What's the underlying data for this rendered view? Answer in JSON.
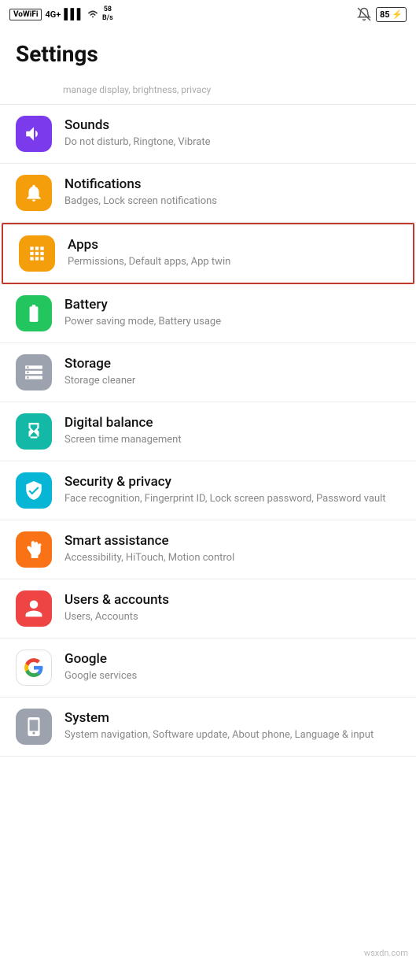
{
  "statusBar": {
    "left": {
      "wifiLabel": "VoWiFi",
      "networkType": "4G+",
      "signalBars": "|||",
      "wifiIcon": "wifi",
      "speedValue": "58",
      "speedUnit": "B/s"
    },
    "right": {
      "bellMuted": true,
      "batteryPercent": "85",
      "charging": true
    }
  },
  "pageTitle": "Settings",
  "topPartialText": "...manage display, brightness, privacy",
  "items": [
    {
      "id": "sounds",
      "title": "Sounds",
      "subtitle": "Do not disturb, Ringtone, Vibrate",
      "iconBg": "bg-purple",
      "iconType": "volume"
    },
    {
      "id": "notifications",
      "title": "Notifications",
      "subtitle": "Badges, Lock screen notifications",
      "iconBg": "bg-amber",
      "iconType": "bell"
    },
    {
      "id": "apps",
      "title": "Apps",
      "subtitle": "Permissions, Default apps, App twin",
      "iconBg": "bg-amber-apps",
      "iconType": "apps",
      "highlighted": true
    },
    {
      "id": "battery",
      "title": "Battery",
      "subtitle": "Power saving mode, Battery usage",
      "iconBg": "bg-green",
      "iconType": "battery"
    },
    {
      "id": "storage",
      "title": "Storage",
      "subtitle": "Storage cleaner",
      "iconBg": "bg-gray",
      "iconType": "storage"
    },
    {
      "id": "digital-balance",
      "title": "Digital balance",
      "subtitle": "Screen time management",
      "iconBg": "bg-teal",
      "iconType": "hourglass"
    },
    {
      "id": "security-privacy",
      "title": "Security & privacy",
      "subtitle": "Face recognition, Fingerprint ID, Lock screen password, Password vault",
      "iconBg": "bg-cyan",
      "iconType": "shield"
    },
    {
      "id": "smart-assistance",
      "title": "Smart assistance",
      "subtitle": "Accessibility, HiTouch, Motion control",
      "iconBg": "bg-orange",
      "iconType": "hand"
    },
    {
      "id": "users-accounts",
      "title": "Users & accounts",
      "subtitle": "Users, Accounts",
      "iconBg": "bg-red",
      "iconType": "user"
    },
    {
      "id": "google",
      "title": "Google",
      "subtitle": "Google services",
      "iconBg": "bg-white-google",
      "iconType": "google"
    },
    {
      "id": "system",
      "title": "System",
      "subtitle": "System navigation, Software update, About phone, Language & input",
      "iconBg": "bg-gray-system",
      "iconType": "system"
    }
  ],
  "watermark": "wsxdn.com"
}
